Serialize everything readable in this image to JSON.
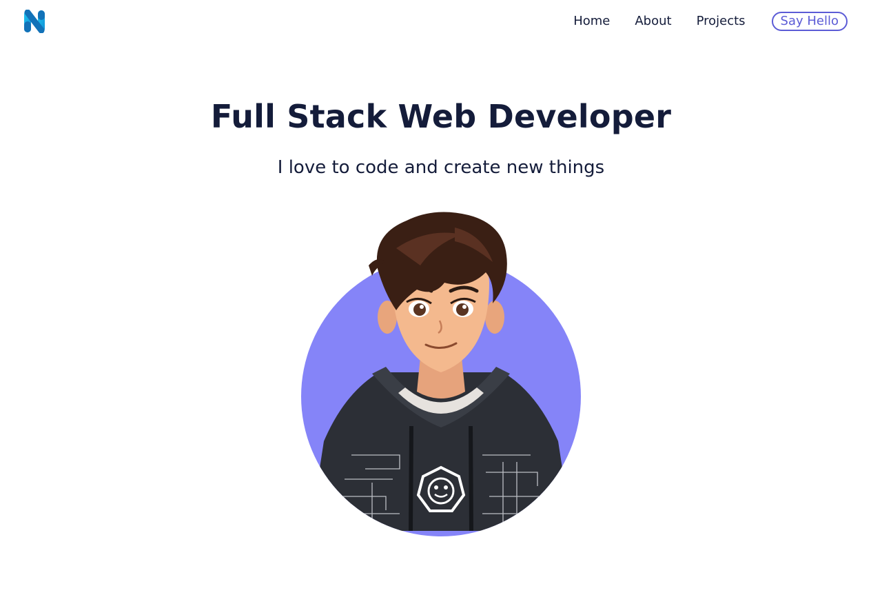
{
  "nav": {
    "items": [
      {
        "label": "Home"
      },
      {
        "label": "About"
      },
      {
        "label": "Projects"
      }
    ],
    "cta_label": "Say Hello"
  },
  "hero": {
    "title": "Full Stack Web Developer",
    "subtitle": "I love to code and create new things"
  },
  "colors": {
    "text": "#141c3a",
    "accent": "#5b5bd6",
    "avatar_circle": "#8584f8",
    "logo_primary": "#1ab8e8",
    "logo_dark": "#1272b8"
  },
  "icons": {
    "logo": "brand-logo-n-icon"
  }
}
